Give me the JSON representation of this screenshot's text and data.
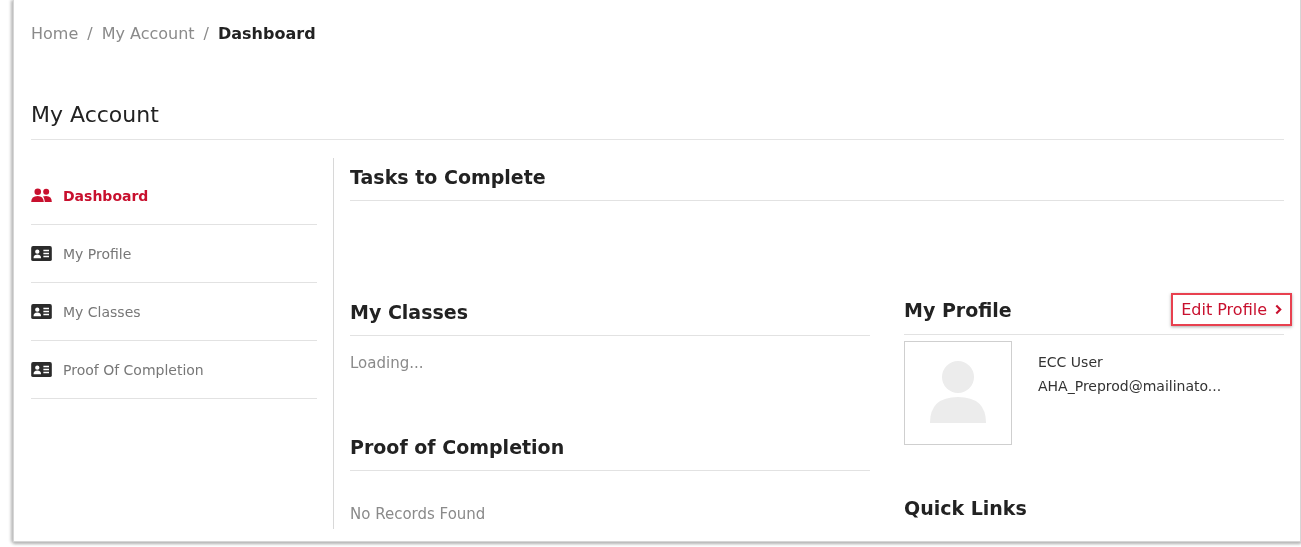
{
  "breadcrumb": [
    {
      "label": "Home",
      "current": false
    },
    {
      "label": "My Account",
      "current": false
    },
    {
      "label": "Dashboard",
      "current": true
    }
  ],
  "breadcrumb_separator": "/",
  "page_title": "My Account",
  "sidebar": {
    "items": [
      {
        "label": "Dashboard",
        "kind": "group",
        "selected": true
      },
      {
        "label": "My Profile",
        "kind": "card",
        "selected": false
      },
      {
        "label": "My Classes",
        "kind": "card",
        "selected": false
      },
      {
        "label": "Proof Of Completion",
        "kind": "card",
        "selected": false
      }
    ]
  },
  "tasks": {
    "title": "Tasks to Complete"
  },
  "my_classes": {
    "title": "My Classes",
    "status": "Loading..."
  },
  "proof_of_completion": {
    "title": "Proof of Completion",
    "status": "No Records Found"
  },
  "my_profile": {
    "title": "My Profile",
    "edit_link": "Edit Profile",
    "edit_link_highlighted": true,
    "name": "ECC User",
    "email": "AHA_Preprod@mailinato..."
  },
  "quick_links": {
    "title": "Quick Links"
  }
}
